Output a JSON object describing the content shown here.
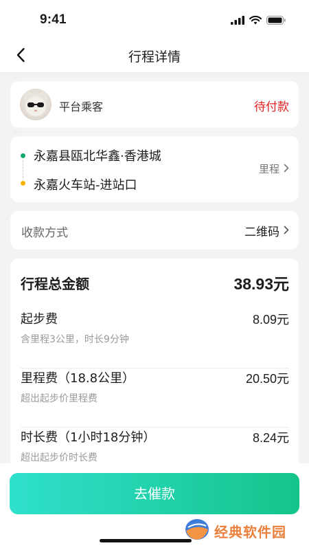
{
  "status_bar": {
    "time": "9:41"
  },
  "nav": {
    "title": "行程详情"
  },
  "passenger": {
    "name": "平台乘客",
    "status": "待付款"
  },
  "route": {
    "start": "永嘉县瓯北华鑫·香港城",
    "end": "永嘉火车站-进站口",
    "mileage_label": "里程"
  },
  "payment": {
    "label": "收款方式",
    "value": "二维码"
  },
  "fare": {
    "total_label": "行程总金额",
    "total_value": "38.93元",
    "items": [
      {
        "title": "起步费",
        "amount": "8.09元",
        "desc": "含里程3公里，时长9分钟"
      },
      {
        "title": "里程费（18.8公里）",
        "amount": "20.50元",
        "desc": "超出起步价里程费"
      },
      {
        "title": "时长费（1小时18分钟）",
        "amount": "8.24元",
        "desc": "超出起步价时长费"
      }
    ]
  },
  "action": {
    "label": "去催款"
  },
  "watermark": {
    "text": "经典软件园"
  },
  "colors": {
    "accent_start": "#2fe0cd",
    "accent_end": "#14c48a",
    "status_red": "#e02020",
    "route_start_dot": "#13a86b",
    "route_end_dot": "#f4b400"
  },
  "icons": {
    "back": "chevron-left-icon",
    "chevron": "chevron-right-icon",
    "signal": "signal-icon",
    "wifi": "wifi-icon",
    "battery": "battery-icon"
  }
}
